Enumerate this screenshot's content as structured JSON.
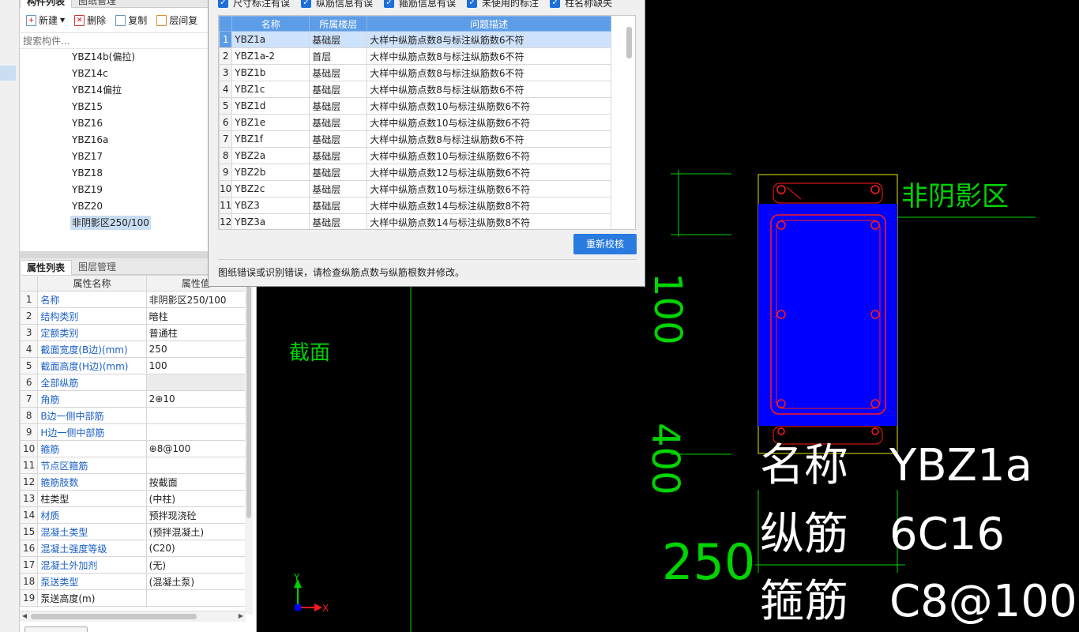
{
  "component_panel": {
    "tabs": [
      "构件列表",
      "图纸管理"
    ],
    "toolbar": {
      "new": "新建",
      "delete": "删除",
      "copy": "复制",
      "floor_copy": "层间复"
    },
    "search_placeholder": "搜索构件...",
    "items": [
      "YBZ14b(偏拉)",
      "YBZ14c",
      "YBZ14偏拉",
      "YBZ15",
      "YBZ16",
      "YBZ16a",
      "YBZ17",
      "YBZ18",
      "YBZ19",
      "YBZ20",
      "非阴影区250/100"
    ],
    "selected_index": 10
  },
  "props_panel": {
    "tabs": [
      "属性列表",
      "图层管理"
    ],
    "columns": [
      "属性名称",
      "属性值"
    ],
    "rows": [
      {
        "n": "1",
        "name": "名称",
        "value": "非阴影区250/100",
        "blue": true
      },
      {
        "n": "2",
        "name": "结构类别",
        "value": "暗柱",
        "blue": true
      },
      {
        "n": "3",
        "name": "定额类别",
        "value": "普通柱",
        "blue": true
      },
      {
        "n": "4",
        "name": "截面宽度(B边)(mm)",
        "value": "250",
        "blue": true
      },
      {
        "n": "5",
        "name": "截面高度(H边)(mm)",
        "value": "100",
        "blue": true
      },
      {
        "n": "6",
        "name": "全部纵筋",
        "value": "",
        "blue": true,
        "gray": true
      },
      {
        "n": "7",
        "name": "角筋",
        "value": "2⊕10",
        "blue": true
      },
      {
        "n": "8",
        "name": "B边一侧中部筋",
        "value": "",
        "blue": true
      },
      {
        "n": "9",
        "name": "H边一侧中部筋",
        "value": "",
        "blue": true
      },
      {
        "n": "10",
        "name": "箍筋",
        "value": "⊕8@100",
        "blue": true
      },
      {
        "n": "11",
        "name": "节点区箍筋",
        "value": "",
        "blue": true
      },
      {
        "n": "12",
        "name": "箍筋肢数",
        "value": "按截面",
        "blue": true
      },
      {
        "n": "13",
        "name": "柱类型",
        "value": "(中柱)",
        "blue": false
      },
      {
        "n": "14",
        "name": "材质",
        "value": "预拌现浇砼",
        "blue": true
      },
      {
        "n": "15",
        "name": "混凝土类型",
        "value": "(预拌混凝土)",
        "blue": true
      },
      {
        "n": "16",
        "name": "混凝土强度等级",
        "value": "(C20)",
        "blue": true
      },
      {
        "n": "17",
        "name": "混凝土外加剂",
        "value": "(无)",
        "blue": true
      },
      {
        "n": "18",
        "name": "泵送类型",
        "value": "(混凝土泵)",
        "blue": true
      },
      {
        "n": "19",
        "name": "泵送高度(m)",
        "value": "",
        "blue": false
      }
    ]
  },
  "dialog": {
    "filters": [
      "尺寸标注有误",
      "纵筋信息有误",
      "箍筋信息有误",
      "未使用的标注",
      "柱名称缺失"
    ],
    "columns": [
      "名称",
      "所属楼层",
      "问题描述"
    ],
    "rows": [
      {
        "n": "1",
        "name": "YBZ1a",
        "floor": "基础层",
        "desc": "大样中纵筋点数8与标注纵筋数6不符"
      },
      {
        "n": "2",
        "name": "YBZ1a-2",
        "floor": "首层",
        "desc": "大样中纵筋点数8与标注纵筋数6不符"
      },
      {
        "n": "3",
        "name": "YBZ1b",
        "floor": "基础层",
        "desc": "大样中纵筋点数8与标注纵筋数6不符"
      },
      {
        "n": "4",
        "name": "YBZ1c",
        "floor": "基础层",
        "desc": "大样中纵筋点数8与标注纵筋数6不符"
      },
      {
        "n": "5",
        "name": "YBZ1d",
        "floor": "基础层",
        "desc": "大样中纵筋点数10与标注纵筋数6不符"
      },
      {
        "n": "6",
        "name": "YBZ1e",
        "floor": "基础层",
        "desc": "大样中纵筋点数10与标注纵筋数6不符"
      },
      {
        "n": "7",
        "name": "YBZ1f",
        "floor": "基础层",
        "desc": "大样中纵筋点数8与标注纵筋数6不符"
      },
      {
        "n": "8",
        "name": "YBZ2a",
        "floor": "基础层",
        "desc": "大样中纵筋点数10与标注纵筋数6不符"
      },
      {
        "n": "9",
        "name": "YBZ2b",
        "floor": "基础层",
        "desc": "大样中纵筋点数12与标注纵筋数6不符"
      },
      {
        "n": "10",
        "name": "YBZ2c",
        "floor": "基础层",
        "desc": "大样中纵筋点数10与标注纵筋数6不符"
      },
      {
        "n": "11",
        "name": "YBZ3",
        "floor": "基础层",
        "desc": "大样中纵筋点数14与标注纵筋数8不符"
      },
      {
        "n": "12",
        "name": "YBZ3a",
        "floor": "基础层",
        "desc": "大样中纵筋点数14与标注纵筋数8不符"
      }
    ],
    "recheck_label": "重新校核",
    "message": "图纸错误或识别错误，请检查纵筋点数与纵筋根数并修改。"
  },
  "drawing": {
    "region_label": "非阴影区",
    "section_label": "截面",
    "dim_h_top": "100",
    "dim_h_bottom": "400",
    "dim_w": "250",
    "label_name": "名称",
    "name_value": "YBZ1a",
    "label_long": "纵筋",
    "long_value": "6C16",
    "label_stirrup": "箍筋",
    "stirrup_value": "C8@100",
    "axis_x": "X",
    "axis_y": "Y"
  },
  "colors": {
    "cad_green": "#00d400",
    "cad_blue": "#0000ff",
    "cad_red": "#ff1a1a",
    "accent": "#2a7be0"
  }
}
